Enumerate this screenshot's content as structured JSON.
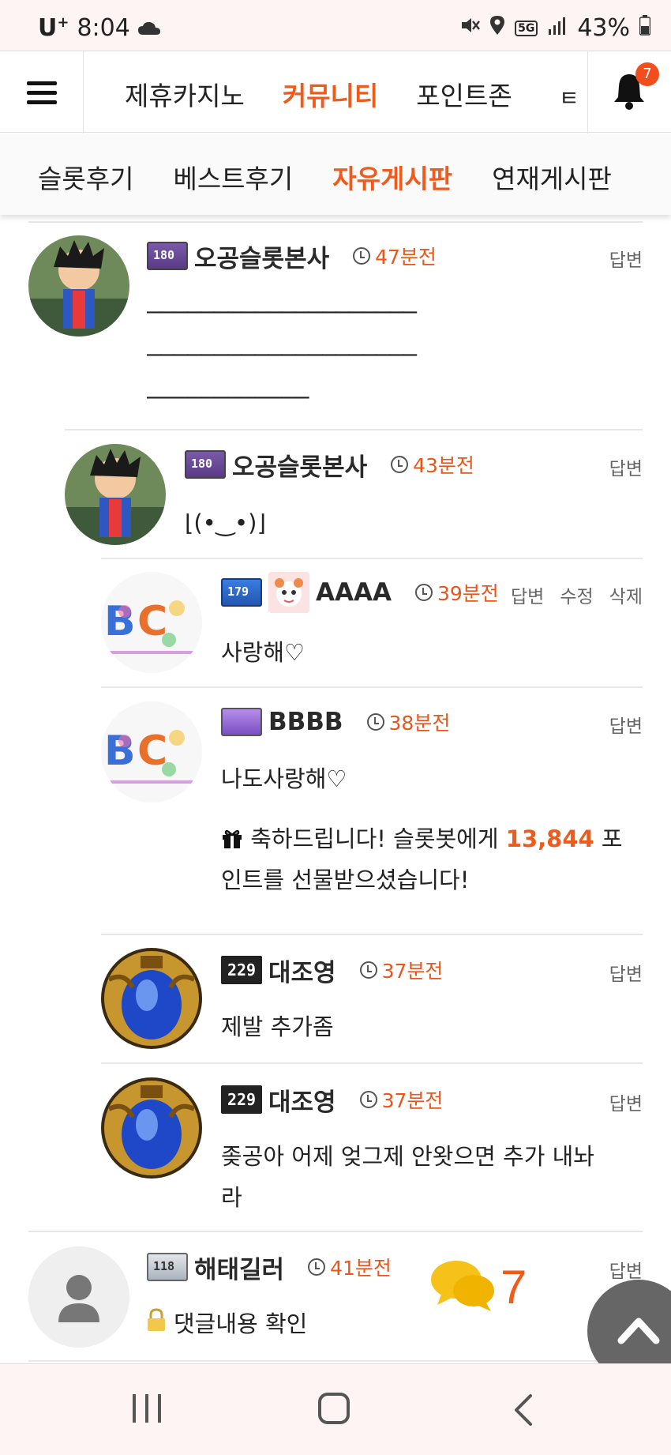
{
  "status_bar": {
    "carrier": "U",
    "carrier_sup": "+",
    "time": "8:04",
    "network": "5G",
    "battery": "43%"
  },
  "top_nav": {
    "tabs": [
      {
        "label": "제휴카지노"
      },
      {
        "label": "커뮤니티"
      },
      {
        "label": "포인트존"
      }
    ],
    "more_glyph": "ㅌ",
    "notification_count": "7",
    "active_color": "#f05a1a"
  },
  "sub_nav": {
    "tabs": [
      {
        "label": "슬롯후기"
      },
      {
        "label": "베스트후기"
      },
      {
        "label": "자유게시판"
      },
      {
        "label": "연재게시판"
      }
    ]
  },
  "comments": [
    {
      "level": "180",
      "nick": "오공슬롯본사",
      "time": "47분전",
      "actions": [
        "답변"
      ],
      "lines": [
        "————————————————————",
        "————————————————————",
        "————————————"
      ]
    },
    {
      "level": "180",
      "nick": "오공슬롯본사",
      "time": "43분전",
      "actions": [
        "답변"
      ],
      "text": "⌊(•‿•)⌋"
    },
    {
      "level": "179",
      "nick": "AAAA",
      "time": "39분전",
      "actions": [
        "답변",
        "수정",
        "삭제"
      ],
      "text": "사랑해♡"
    },
    {
      "nick": "BBBB",
      "time": "38분전",
      "actions": [
        "답변"
      ],
      "text": "나도사랑해♡",
      "gift_prefix": "축하드립니다! 슬롯봇에게 ",
      "gift_points": "13,844",
      "gift_suffix": " 포",
      "gift_line2": "인트를 선물받으셨습니다!"
    },
    {
      "level": "229",
      "nick": "대조영",
      "time": "37분전",
      "actions": [
        "답변"
      ],
      "text": "제발 추가좀"
    },
    {
      "level": "229",
      "nick": "대조영",
      "time": "37분전",
      "actions": [
        "답변"
      ],
      "text_line1": "좆공아 어제 엊그제 안왓으면 추가 내놔",
      "text_line2": "라"
    },
    {
      "level": "118",
      "nick": "해태길러",
      "time": "41분전",
      "actions": [
        "답변"
      ],
      "text": "댓글내용 확인"
    }
  ],
  "floating": {
    "comment_count": "7"
  },
  "icons": [
    "menu-icon",
    "bell-icon",
    "clock-icon",
    "gift-icon",
    "lock-icon",
    "chat-bubble-icon",
    "chevron-up-icon",
    "recent-apps-icon",
    "home-icon",
    "back-icon"
  ]
}
